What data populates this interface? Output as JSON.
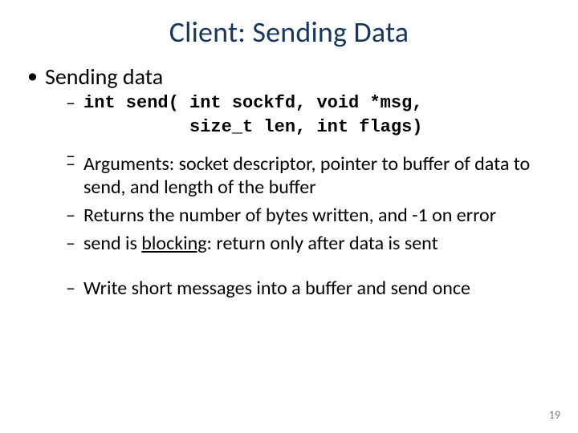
{
  "title": "Client: Sending Data",
  "bullet1": "Sending data",
  "code_line1": "int send( int sockfd, void *msg,",
  "code_line2": "          size_t len, int flags)",
  "sub_args": "Arguments: socket descriptor, pointer to buffer of data to send, and length of the buffer",
  "sub_returns": "Returns the number of bytes written, and -1 on error",
  "sub_blocking_pre": "send is ",
  "sub_blocking_word": "blocking",
  "sub_blocking_post": ": return only after data is sent",
  "sub_write": "Write short messages into a buffer and send once",
  "page_number": "19"
}
